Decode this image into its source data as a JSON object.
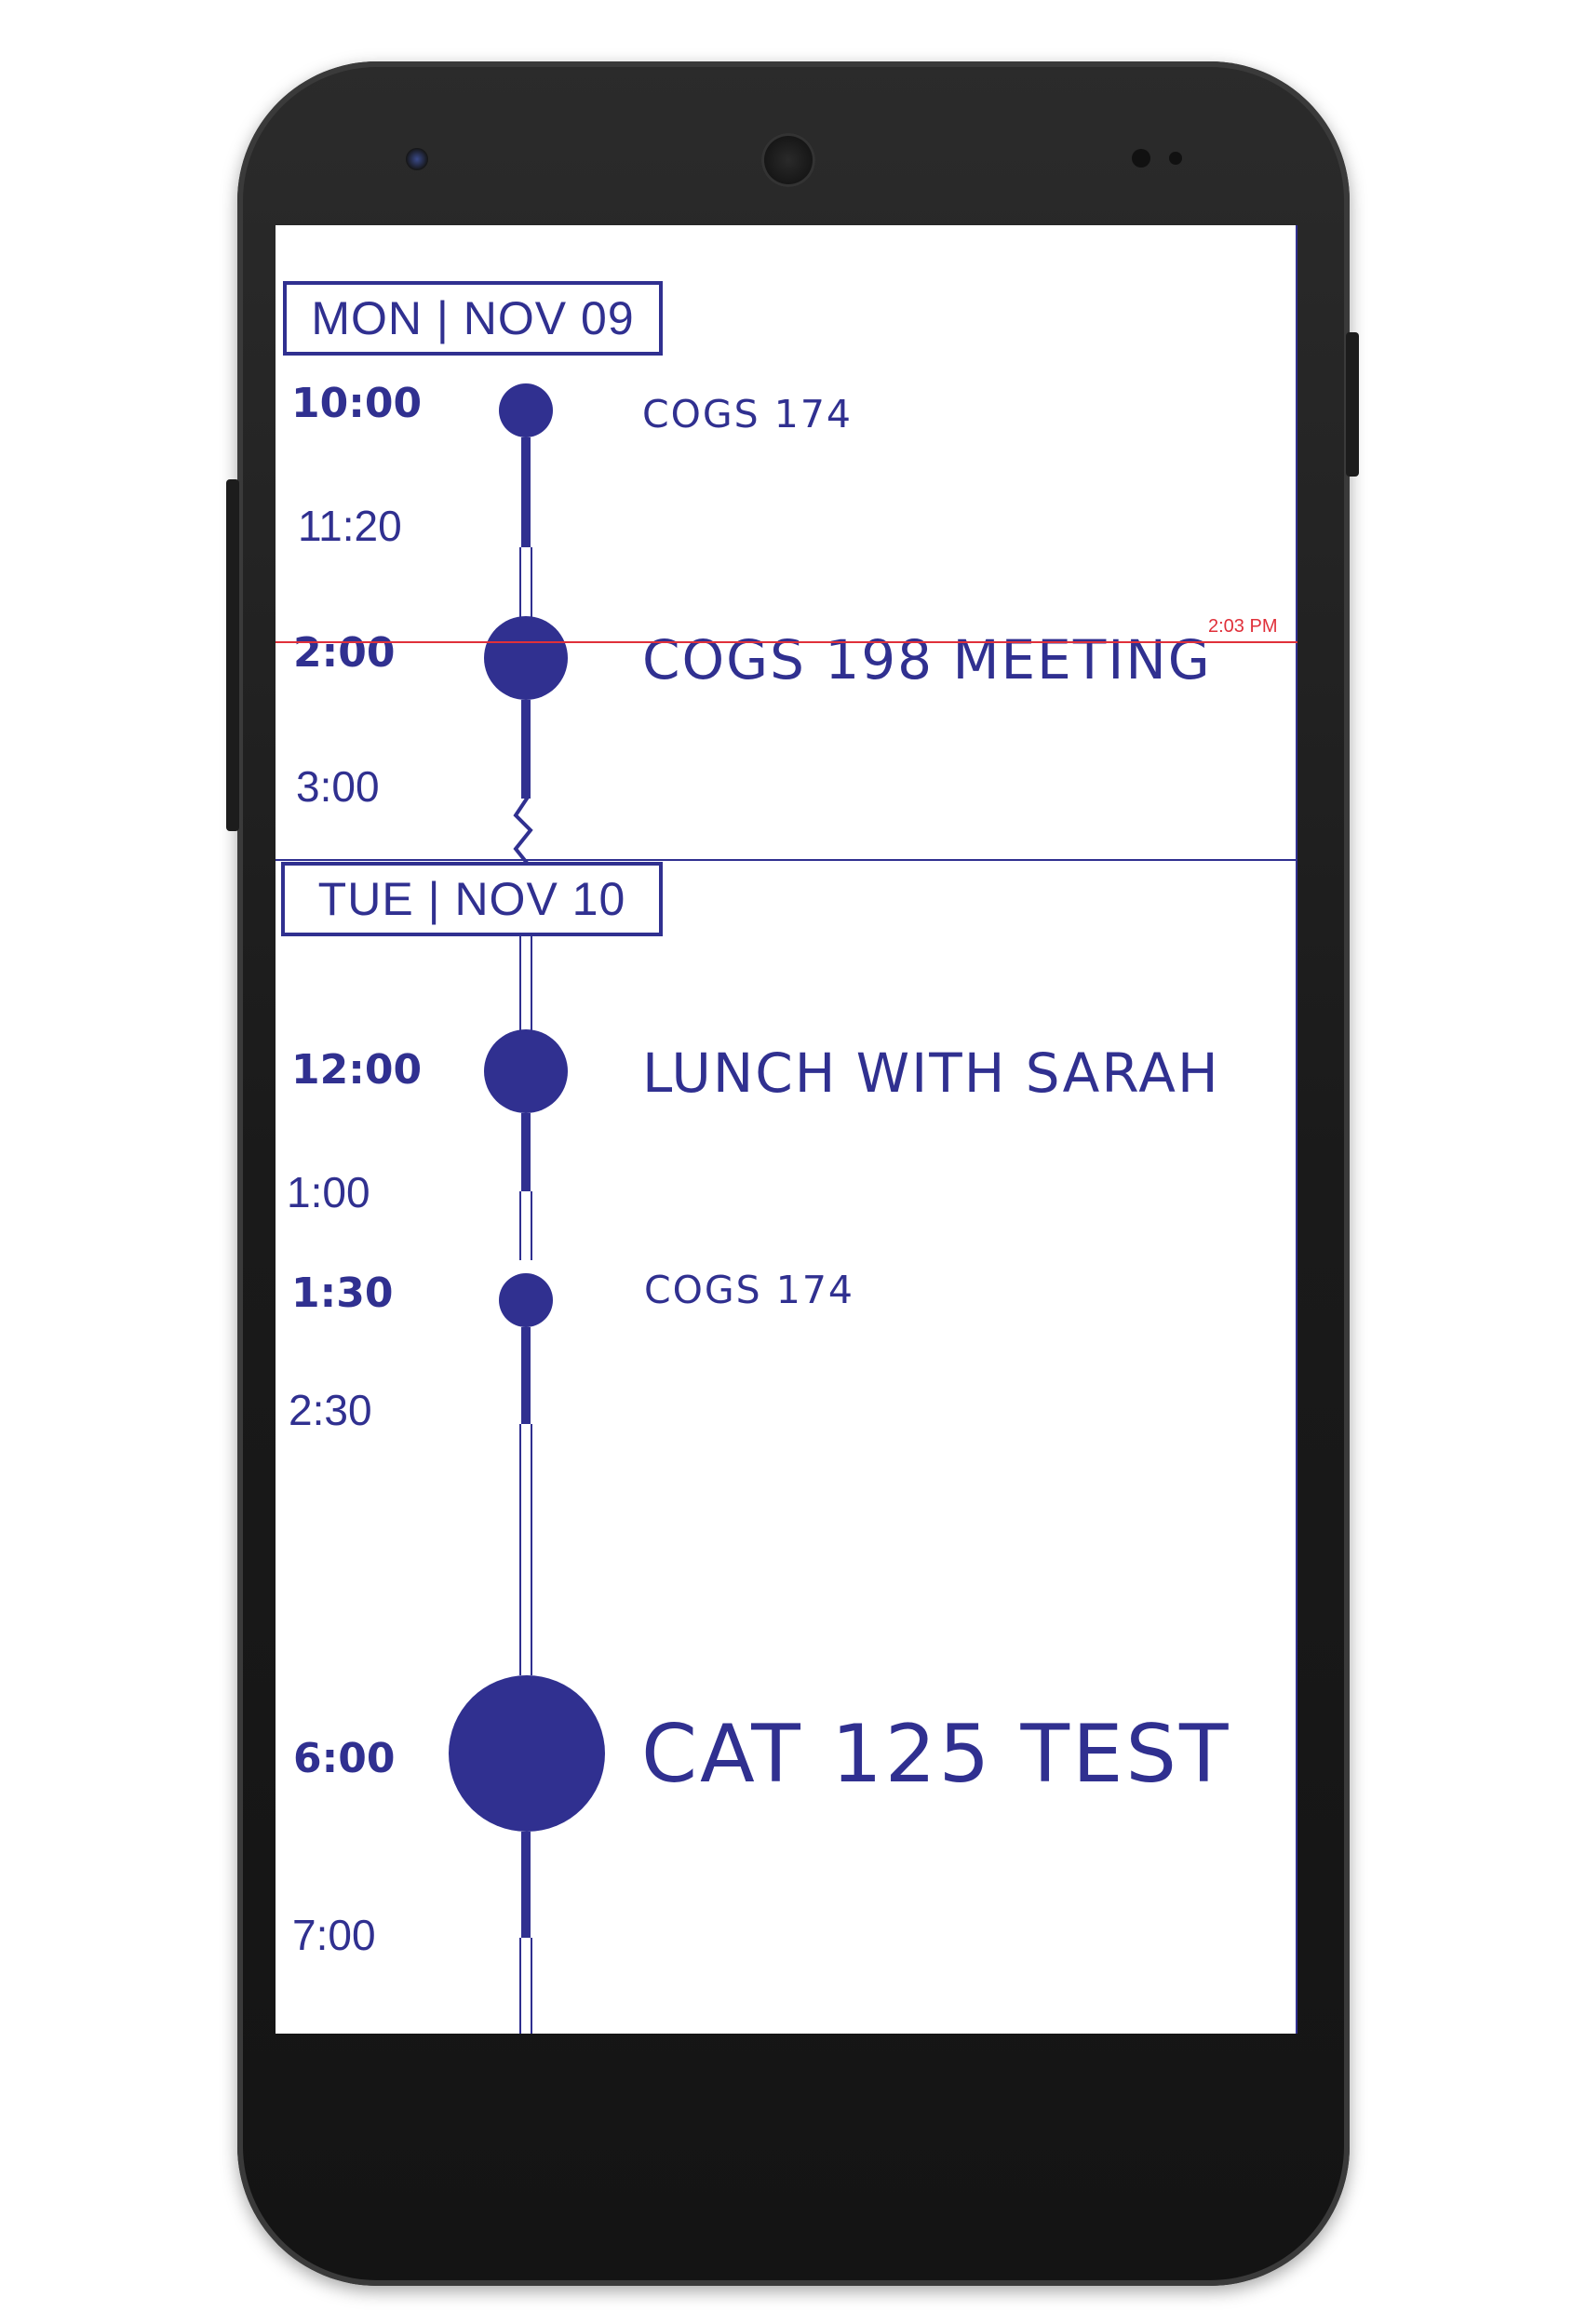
{
  "theme": {
    "accent": "#303090",
    "now_color": "#e0303a"
  },
  "days": [
    {
      "label": "MON | NOV 09"
    },
    {
      "label": "TUE | NOV 10"
    }
  ],
  "events": [
    {
      "start": "10:00",
      "end": "11:20",
      "title": "COGS 174"
    },
    {
      "start": "2:00",
      "end": "3:00",
      "title": "COGS 198 MEETING"
    },
    {
      "start": "12:00",
      "end": "1:00",
      "title": "LUNCH WITH SARAH"
    },
    {
      "start": "1:30",
      "end": "2:30",
      "title": "COGS 174"
    },
    {
      "start": "6:00",
      "end": "7:00",
      "title": "CAT 125 TEST"
    }
  ],
  "now": {
    "label": "2:03 PM"
  }
}
